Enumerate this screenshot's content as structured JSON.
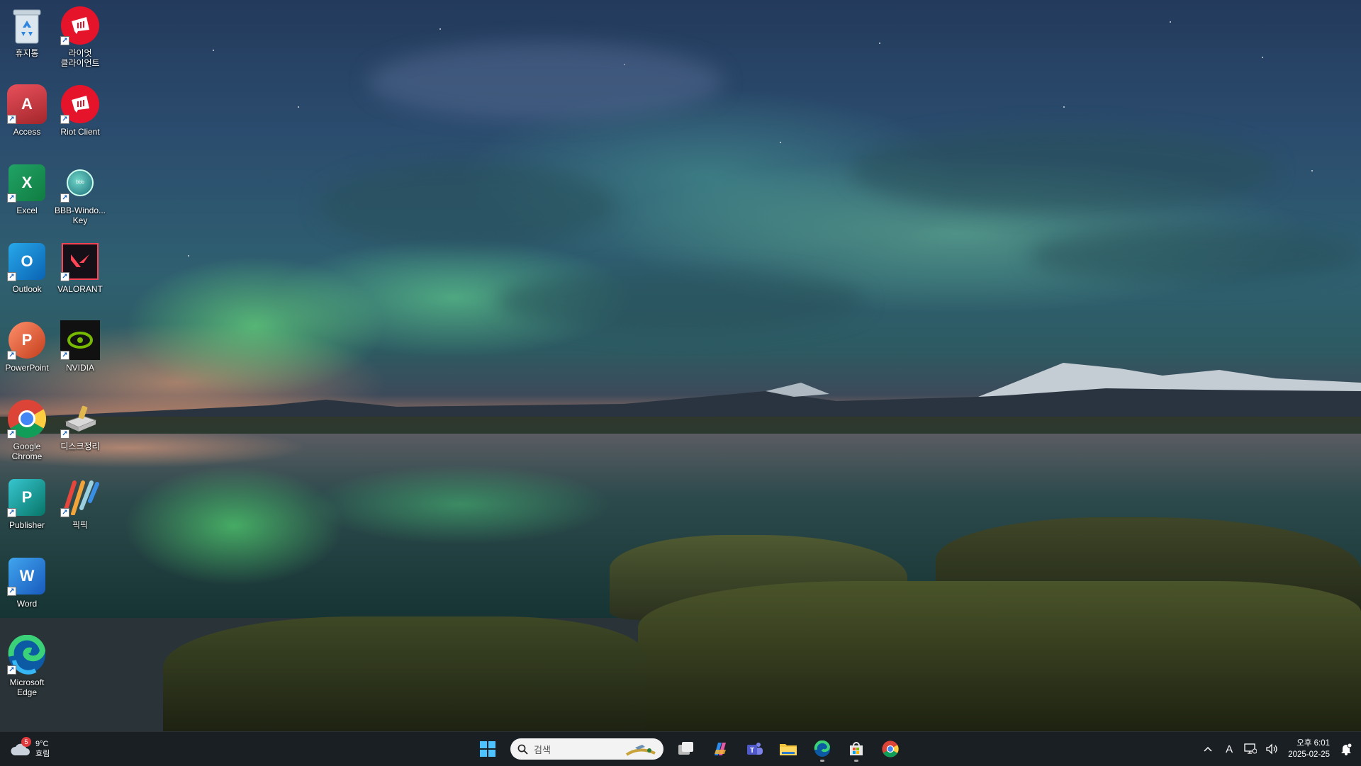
{
  "desktop": {
    "icons": [
      {
        "label": "휴지통",
        "icon": "recycle-bin-icon"
      },
      {
        "label": "라이엇\n클라이언트",
        "icon": "riot-client-icon"
      },
      {
        "label": "Access",
        "icon": "access-icon"
      },
      {
        "label": "Riot Client",
        "icon": "riot-client-icon"
      },
      {
        "label": "Excel",
        "icon": "excel-icon"
      },
      {
        "label": "BBB-Windo...\nKey",
        "icon": "bbb-windows-key-icon"
      },
      {
        "label": "Outlook",
        "icon": "outlook-icon"
      },
      {
        "label": "VALORANT",
        "icon": "valorant-icon"
      },
      {
        "label": "PowerPoint",
        "icon": "powerpoint-icon"
      },
      {
        "label": "NVIDIA",
        "icon": "nvidia-icon"
      },
      {
        "label": "Google\nChrome",
        "icon": "chrome-icon"
      },
      {
        "label": "디스크정리",
        "icon": "disk-cleanup-icon"
      },
      {
        "label": "Publisher",
        "icon": "publisher-icon"
      },
      {
        "label": "픽픽",
        "icon": "picpick-icon"
      },
      {
        "label": "Word",
        "icon": "word-icon"
      },
      {
        "label": "Microsoft\nEdge",
        "icon": "edge-icon"
      }
    ]
  },
  "taskbar": {
    "weather": {
      "temp": "9°C",
      "condition": "흐림",
      "badge": "5"
    },
    "search": {
      "placeholder": "검색"
    },
    "pinned": [
      "task-view",
      "copilot",
      "teams",
      "file-explorer",
      "edge",
      "store",
      "chrome"
    ],
    "tray": {
      "ime": "A"
    },
    "clock": {
      "time": "오후 6:01",
      "date": "2025-02-25"
    }
  },
  "colors": {
    "taskbar": "#1c2024",
    "accent": "#0078d4"
  }
}
